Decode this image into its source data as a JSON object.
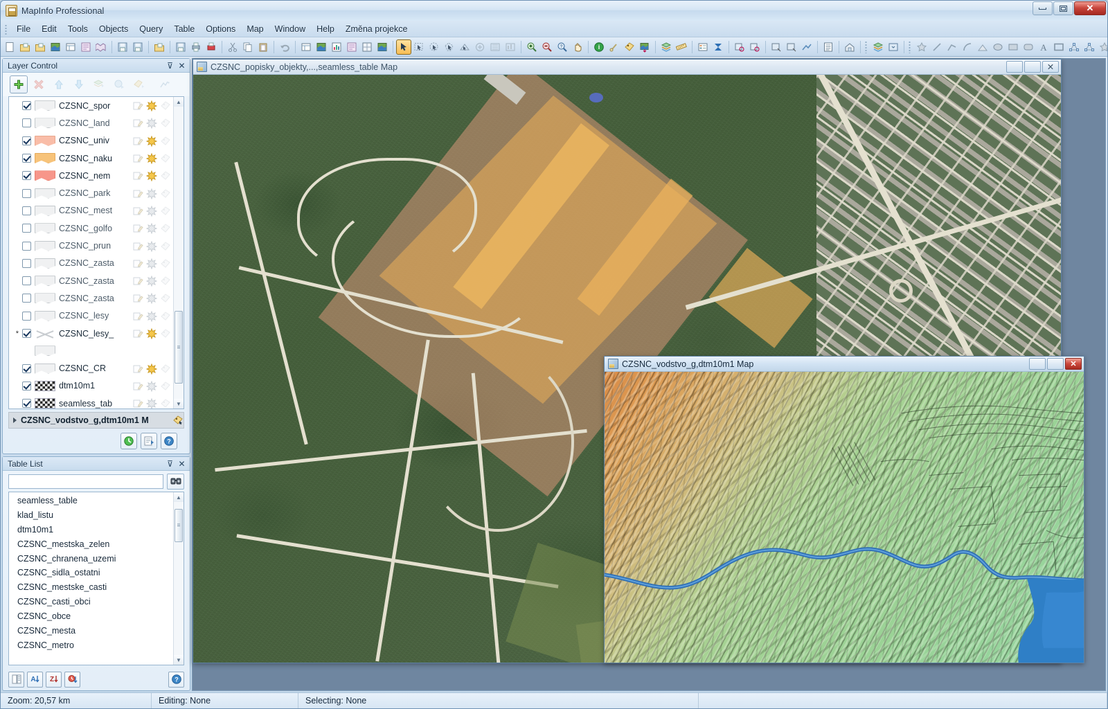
{
  "window": {
    "title": "MapInfo Professional",
    "minimize_label": "Minimize",
    "maximize_label": "Maximize",
    "close_label": "✕"
  },
  "menubar": {
    "items": [
      {
        "label": "File"
      },
      {
        "label": "Edit"
      },
      {
        "label": "Tools"
      },
      {
        "label": "Objects"
      },
      {
        "label": "Query"
      },
      {
        "label": "Table"
      },
      {
        "label": "Options"
      },
      {
        "label": "Map"
      },
      {
        "label": "Window"
      },
      {
        "label": "Help"
      },
      {
        "label": "Změna projekce"
      }
    ]
  },
  "toolbar": {
    "groups": [
      {
        "icons": [
          "new-table-icon",
          "open-table-icon",
          "open-workspace-icon",
          "new-map-window-icon",
          "new-browser-icon",
          "new-layout-icon",
          "new-legend-icon"
        ]
      },
      {
        "icons": [
          "save-table-icon",
          "save-workspace-icon"
        ]
      },
      {
        "icons": [
          "open-folder-icon"
        ]
      },
      {
        "icons": [
          "save-window-icon",
          "print-icon",
          "print-preview-icon"
        ]
      },
      {
        "icons": [
          "cut-icon",
          "copy-icon",
          "paste-icon"
        ]
      },
      {
        "icons": [
          "undo-icon"
        ]
      },
      {
        "icons": [
          "new-browser-window-icon",
          "new-map-icon",
          "new-graph-icon",
          "new-layout-window-icon",
          "new-redistrict-icon",
          "new-3d-map-icon"
        ]
      },
      {
        "icons": [
          "select-arrow-icon",
          "marquee-select-icon",
          "radius-select-icon",
          "polygon-select-icon",
          "boundary-select-icon",
          "invert-select-icon",
          "select-all-icon",
          "graph-select-icon"
        ]
      },
      {
        "icons": [
          "zoom-in-icon",
          "zoom-out-icon",
          "change-view-icon",
          "pan-icon"
        ]
      },
      {
        "icons": [
          "info-icon",
          "hotlink-icon",
          "label-icon",
          "drag-map-window-icon"
        ]
      },
      {
        "icons": [
          "layer-control-icon",
          "ruler-icon"
        ]
      },
      {
        "icons": [
          "legend-icon",
          "statistics-icon"
        ]
      },
      {
        "icons": [
          "set-target-icon",
          "clear-target-icon"
        ]
      },
      {
        "icons": [
          "set-clip-region-icon",
          "clip-region-on-icon",
          "distance-calc-icon"
        ]
      },
      {
        "icons": [
          "list-icon"
        ]
      },
      {
        "icons": [
          "district-browser-icon"
        ]
      },
      {
        "icons": [
          "layer-control-tool-icon",
          "workspace-tool-icon"
        ]
      },
      {
        "icons": [
          "symbol-icon",
          "line-icon",
          "polyline-icon",
          "arc-icon",
          "polygon-icon",
          "ellipse-icon",
          "rectangle-icon",
          "rounded-rect-icon",
          "text-icon",
          "frame-icon",
          "add-node-icon",
          "reshape-icon",
          "symbol-style-icon"
        ]
      }
    ],
    "active_tool": "select-arrow-icon"
  },
  "layer_control": {
    "title": "Layer Control",
    "pin_label": "⊽",
    "close_label": "✕",
    "buttons": [
      {
        "name": "add-layers-button",
        "label": "+",
        "enabled": true
      },
      {
        "name": "remove-layer-button",
        "label": "✖",
        "enabled": false
      },
      {
        "name": "move-layer-up-button",
        "label": "↑",
        "enabled": false
      },
      {
        "name": "move-layer-down-button",
        "label": "↓",
        "enabled": false
      },
      {
        "name": "layer-properties-button",
        "label": "◈",
        "enabled": false
      },
      {
        "name": "hotlink-options-button",
        "label": "◆",
        "enabled": false
      },
      {
        "name": "label-options-button",
        "label": "◇",
        "enabled": false
      },
      {
        "name": "thematic-map-button",
        "label": "⇥",
        "enabled": false
      }
    ],
    "layers": [
      {
        "name": "CZSNC_spor",
        "visible": true,
        "swatch": "poly-gray",
        "editable": false,
        "selectable": true,
        "labels": false,
        "marker": ""
      },
      {
        "name": "CZSNC_land",
        "visible": false,
        "swatch": "poly-gray",
        "editable": false,
        "selectable": false,
        "labels": false,
        "marker": ""
      },
      {
        "name": "CZSNC_univ",
        "visible": true,
        "swatch": "poly-pink",
        "editable": false,
        "selectable": true,
        "labels": false,
        "marker": ""
      },
      {
        "name": "CZSNC_naku",
        "visible": true,
        "swatch": "poly-orange",
        "editable": false,
        "selectable": true,
        "labels": false,
        "marker": ""
      },
      {
        "name": "CZSNC_nem",
        "visible": true,
        "swatch": "poly-red",
        "editable": false,
        "selectable": true,
        "labels": false,
        "marker": ""
      },
      {
        "name": "CZSNC_park",
        "visible": false,
        "swatch": "poly-gray",
        "editable": false,
        "selectable": false,
        "labels": false,
        "marker": ""
      },
      {
        "name": "CZSNC_mest",
        "visible": false,
        "swatch": "poly-gray",
        "editable": false,
        "selectable": false,
        "labels": false,
        "marker": ""
      },
      {
        "name": "CZSNC_golfo",
        "visible": false,
        "swatch": "poly-gray",
        "editable": false,
        "selectable": false,
        "labels": false,
        "marker": ""
      },
      {
        "name": "CZSNC_prun",
        "visible": false,
        "swatch": "poly-gray",
        "editable": false,
        "selectable": false,
        "labels": false,
        "marker": ""
      },
      {
        "name": "CZSNC_zasta",
        "visible": false,
        "swatch": "poly-gray",
        "editable": false,
        "selectable": false,
        "labels": false,
        "marker": ""
      },
      {
        "name": "CZSNC_zasta",
        "visible": false,
        "swatch": "poly-gray",
        "editable": false,
        "selectable": false,
        "labels": false,
        "marker": ""
      },
      {
        "name": "CZSNC_zasta",
        "visible": false,
        "swatch": "poly-gray",
        "editable": false,
        "selectable": false,
        "labels": false,
        "marker": ""
      },
      {
        "name": "CZSNC_lesy",
        "visible": false,
        "swatch": "poly-gray",
        "editable": false,
        "selectable": false,
        "labels": false,
        "marker": ""
      },
      {
        "name": "CZSNC_lesy_",
        "visible": true,
        "swatch": "line-cross",
        "editable": false,
        "selectable": true,
        "labels": false,
        "marker": "*"
      },
      {
        "name": "",
        "visible": null,
        "swatch": "poly-gray",
        "editable": false,
        "selectable": false,
        "labels": false,
        "marker": ""
      },
      {
        "name": "CZSNC_CR",
        "visible": true,
        "swatch": "poly-gray",
        "editable": false,
        "selectable": true,
        "labels": false,
        "marker": ""
      },
      {
        "name": "dtm10m1",
        "visible": true,
        "swatch": "raster",
        "editable": false,
        "selectable": false,
        "labels": false,
        "marker": ""
      },
      {
        "name": "seamless_tab",
        "visible": true,
        "swatch": "raster",
        "editable": false,
        "selectable": false,
        "labels": false,
        "marker": ""
      }
    ],
    "selected_map": "CZSNC_vodstvo_g,dtm10m1 M",
    "footer_buttons": [
      {
        "name": "refresh-button",
        "label": "↻"
      },
      {
        "name": "layer-properties-footer-button",
        "label": "▤"
      },
      {
        "name": "help-button",
        "label": "?"
      }
    ]
  },
  "table_list": {
    "title": "Table List",
    "pin_label": "⊽",
    "close_label": "✕",
    "search_value": "",
    "search_placeholder": "",
    "find_button_label": "find-icon",
    "tables": [
      "seamless_table",
      "klad_listu",
      "dtm10m1",
      "CZSNC_mestska_zelen",
      "CZSNC_chranena_uzemi",
      "CZSNC_sidla_ostatni",
      "CZSNC_mestske_casti",
      "CZSNC_casti_obci",
      "CZSNC_obce",
      "CZSNC_mesta",
      "CZSNC_metro"
    ],
    "footer_buttons": [
      {
        "name": "browse-table-button",
        "label": "▤"
      },
      {
        "name": "sort-ascending-button",
        "label": "A↓"
      },
      {
        "name": "sort-descending-button",
        "label": "Z↓"
      },
      {
        "name": "sort-by-time-button",
        "label": "◷"
      },
      {
        "name": "table-list-help-button",
        "label": "?"
      }
    ]
  },
  "map_windows": [
    {
      "name": "aerial-map-window",
      "title": "CZSNC_popisky_objekty,...,seamless_table Map",
      "active": false,
      "controls": {
        "minimize": "–",
        "maximize": "□",
        "close": "✕"
      }
    },
    {
      "name": "dtm-map-window",
      "title": "CZSNC_vodstvo_g,dtm10m1 Map",
      "active": true,
      "controls": {
        "minimize": "–",
        "maximize": "□",
        "close": "✕"
      }
    }
  ],
  "statusbar": {
    "zoom": "Zoom: 20,57 km",
    "editing": "Editing: None",
    "selecting": "Selecting: None",
    "extra": ""
  },
  "colors": {
    "accent_orange": "#f7bd54",
    "close_red": "#c8453b",
    "title_blue": "#c6daee",
    "layer_pink": "#f9bda8",
    "layer_orange": "#f7c37a",
    "layer_red": "#f7968a",
    "terrain_low": "#93d4a2",
    "terrain_high": "#d98b47",
    "water_blue": "#3f7fc4",
    "forest_green": "#4a6340"
  }
}
